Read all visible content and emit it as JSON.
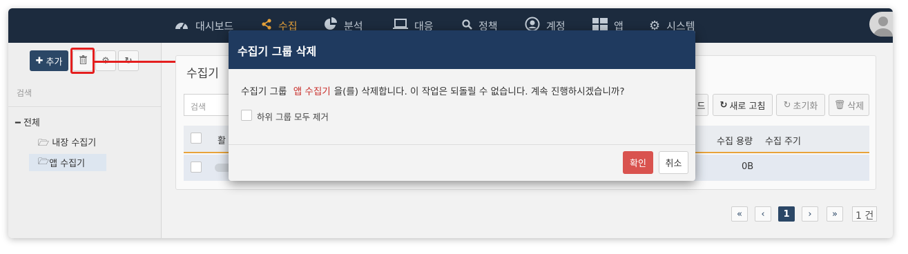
{
  "nav": {
    "items": [
      {
        "label": "대시보드",
        "icon": "dashboard-icon"
      },
      {
        "label": "수집",
        "icon": "share-icon",
        "active": true
      },
      {
        "label": "분석",
        "icon": "pie-chart-icon"
      },
      {
        "label": "대응",
        "icon": "laptop-icon"
      },
      {
        "label": "정책",
        "icon": "search-icon"
      },
      {
        "label": "계정",
        "icon": "user-circle-icon"
      },
      {
        "label": "앱",
        "icon": "grid-icon"
      },
      {
        "label": "시스템",
        "icon": "gear-icon"
      }
    ],
    "accent_color": "#e8a33a",
    "bg_color": "#1c2b3e"
  },
  "sidebar": {
    "add_label": "추가",
    "search_placeholder": "검색",
    "tree": {
      "root_label": "전체",
      "items": [
        {
          "label": "내장 수집기",
          "icon": "folder-open-icon"
        },
        {
          "label": "앱 수집기",
          "icon": "folder-open-icon",
          "selected": true
        }
      ]
    }
  },
  "panel": {
    "title": "수집기",
    "search_placeholder": "검색",
    "toolbar": {
      "partial_label": "드",
      "refresh_label": "새로 고침",
      "reset_label": "초기화",
      "delete_label": "삭제"
    },
    "columns": {
      "active_partial": "활",
      "capacity": "수집 용량",
      "interval": "수집 주기"
    },
    "row": {
      "capacity": "0B"
    },
    "pager": {
      "first": "«",
      "prev": "‹",
      "current": "1",
      "next": "›",
      "last": "»",
      "total": "1 건"
    }
  },
  "modal": {
    "title": "수집기 그룹 삭제",
    "message_prefix": "수집기 그룹",
    "group_name": "앱 수집기",
    "message_suffix": "을(를) 삭제합니다. 이 작업은 되돌릴 수 없습니다. 계속 진행하시겠습니까?",
    "checkbox_label": "하위 그룹 모두 제거",
    "ok_label": "확인",
    "cancel_label": "취소",
    "header_color": "#1f3a5f",
    "ok_color": "#d9534f",
    "highlight_color": "#c9302c"
  },
  "annotation": {
    "color": "#e41e1e"
  }
}
